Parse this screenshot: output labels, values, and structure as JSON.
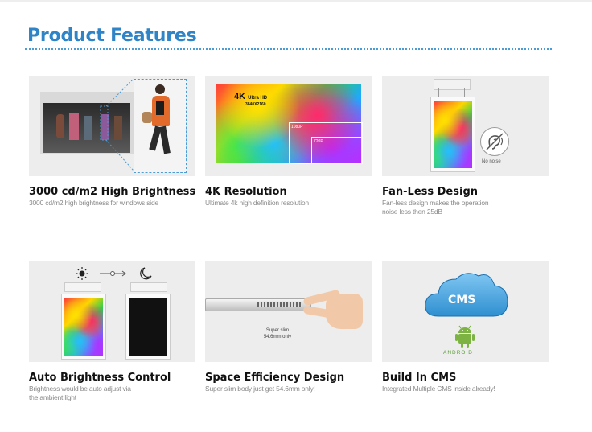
{
  "header": {
    "title": "Product Features"
  },
  "features": [
    {
      "title": "3000 cd/m2 High Brightness",
      "desc": "3000 cd/m2 high brightness for windows side"
    },
    {
      "title": "4K Resolution",
      "desc": "Ultimate 4k high definition resolution",
      "image_labels": {
        "k4": "4K",
        "ultra": "Ultra HD",
        "res": "3840X2160",
        "p1080": "1080P",
        "p720": "720P"
      }
    },
    {
      "title": "Fan-Less Design",
      "desc": "Fan-less design makes the operation noise less then 25dB",
      "image_labels": {
        "nonoise": "No noise"
      }
    },
    {
      "title": "Auto Brightness Control",
      "desc": "Brightness would be auto adjust via the ambient light"
    },
    {
      "title": "Space Efficiency Design",
      "desc": "Super slim body just get 54.6mm only!",
      "image_labels": {
        "slim1": "Super slim",
        "slim2": "54.6mm only"
      }
    },
    {
      "title": "Build In CMS",
      "desc": "Integrated Multiple CMS inside already!",
      "image_labels": {
        "cms": "CMS",
        "android": "ANDROID"
      }
    }
  ],
  "colors": {
    "accent": "#2e84c7",
    "android_green": "#7cb342",
    "cloud_blue": "#2f8fd0"
  }
}
